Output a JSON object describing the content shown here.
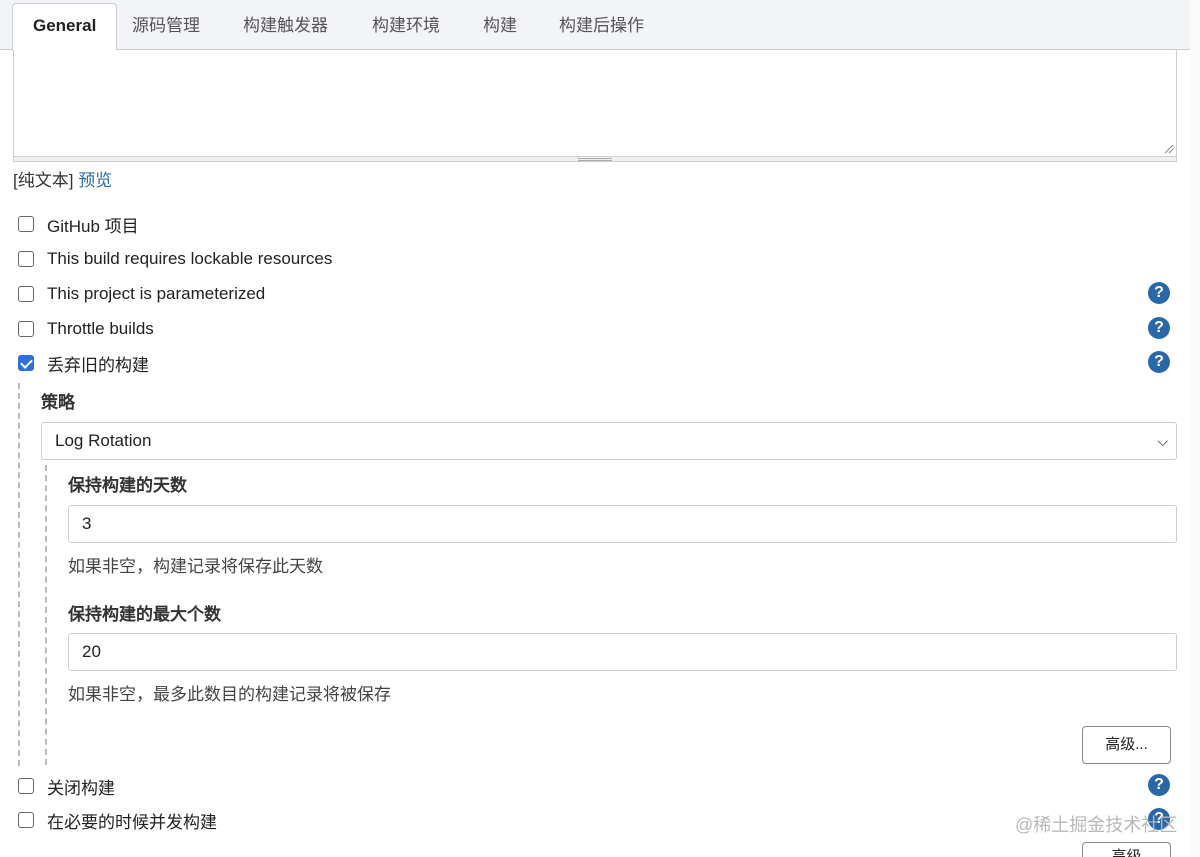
{
  "tabs": [
    {
      "label": "General",
      "active": true
    },
    {
      "label": "源码管理"
    },
    {
      "label": "构建触发器"
    },
    {
      "label": "构建环境"
    },
    {
      "label": "构建"
    },
    {
      "label": "构建后操作"
    }
  ],
  "description": {
    "plain_label": "[纯文本]",
    "preview_label": "预览"
  },
  "options": {
    "github": {
      "label": "GitHub 项目",
      "checked": false
    },
    "lockable": {
      "label": "This build requires lockable resources",
      "checked": false
    },
    "parameterized": {
      "label": "This project is parameterized",
      "checked": false
    },
    "throttle": {
      "label": "Throttle builds",
      "checked": false
    },
    "discard": {
      "label": "丢弃旧的构建",
      "checked": true
    },
    "disable": {
      "label": "关闭构建",
      "checked": false
    },
    "concurrent": {
      "label": "在必要的时候并发构建",
      "checked": false
    }
  },
  "help_icon": {
    "glyph": "?",
    "color": "#2a67a8"
  },
  "strategy": {
    "label": "策略",
    "selected": "Log Rotation",
    "days_label": "保持构建的天数",
    "days_value": "3",
    "days_hint": "如果非空，构建记录将保存此天数",
    "max_label": "保持构建的最大个数",
    "max_value": "20",
    "max_hint": "如果非空，最多此数目的构建记录将被保存",
    "advanced_label": "高级...",
    "advanced_label_2": "高级"
  },
  "watermark": "@稀土掘金技术社区",
  "colors": {
    "accent": "#2f6fd9",
    "link": "#2d6ca8"
  }
}
